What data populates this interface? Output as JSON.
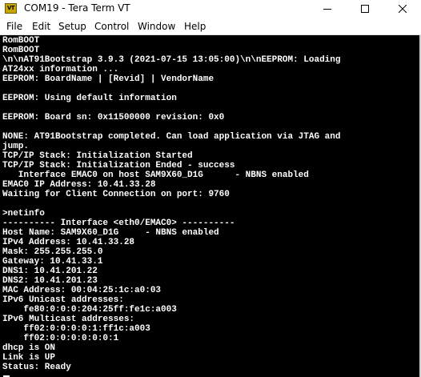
{
  "window": {
    "title": "COM19 - Tera Term VT",
    "icon_label": "VT"
  },
  "menu": {
    "file": "File",
    "edit": "Edit",
    "setup": "Setup",
    "control": "Control",
    "window": "Window",
    "help": "Help"
  },
  "terminal": {
    "lines": [
      "RomBOOT",
      "RomBOOT",
      "\\n\\nAT91Bootstrap 3.9.3 (2021-07-15 13:05:00)\\n\\nEEPROM: Loading",
      "AT24xx information ...",
      "EEPROM: BoardName | [Revid] | VendorName",
      "",
      "EEPROM: Using default information",
      "",
      "EEPROM: Board sn: 0x11500000 revision: 0x0",
      "",
      "NONE: AT91Bootstrap completed. Can load application via JTAG and",
      "jump.",
      "TCP/IP Stack: Initialization Started",
      "TCP/IP Stack: Initialization Ended - success",
      "   Interface EMAC0 on host SAM9X60_D1G      - NBNS enabled",
      "EMAC0 IP Address: 10.41.33.28",
      "Waiting for Client Connection on port: 9760",
      "",
      ">netinfo",
      "---------- Interface <eth0/EMAC0> ----------",
      "Host Name: SAM9X60_D1G     - NBNS enabled",
      "IPv4 Address: 10.41.33.28",
      "Mask: 255.255.255.0",
      "Gateway: 10.41.33.1",
      "DNS1: 10.41.201.22",
      "DNS2: 10.41.201.23",
      "MAC Address: 00:04:25:1c:a0:03",
      "IPv6 Unicast addresses:",
      "    fe80:0:0:0:204:25ff:fe1c:a003",
      "IPv6 Multicast addresses:",
      "    ff02:0:0:0:0:1:ff1c:a003",
      "    ff02:0:0:0:0:0:0:1",
      "dhcp is ON",
      "Link is UP",
      "Status: Ready"
    ]
  }
}
